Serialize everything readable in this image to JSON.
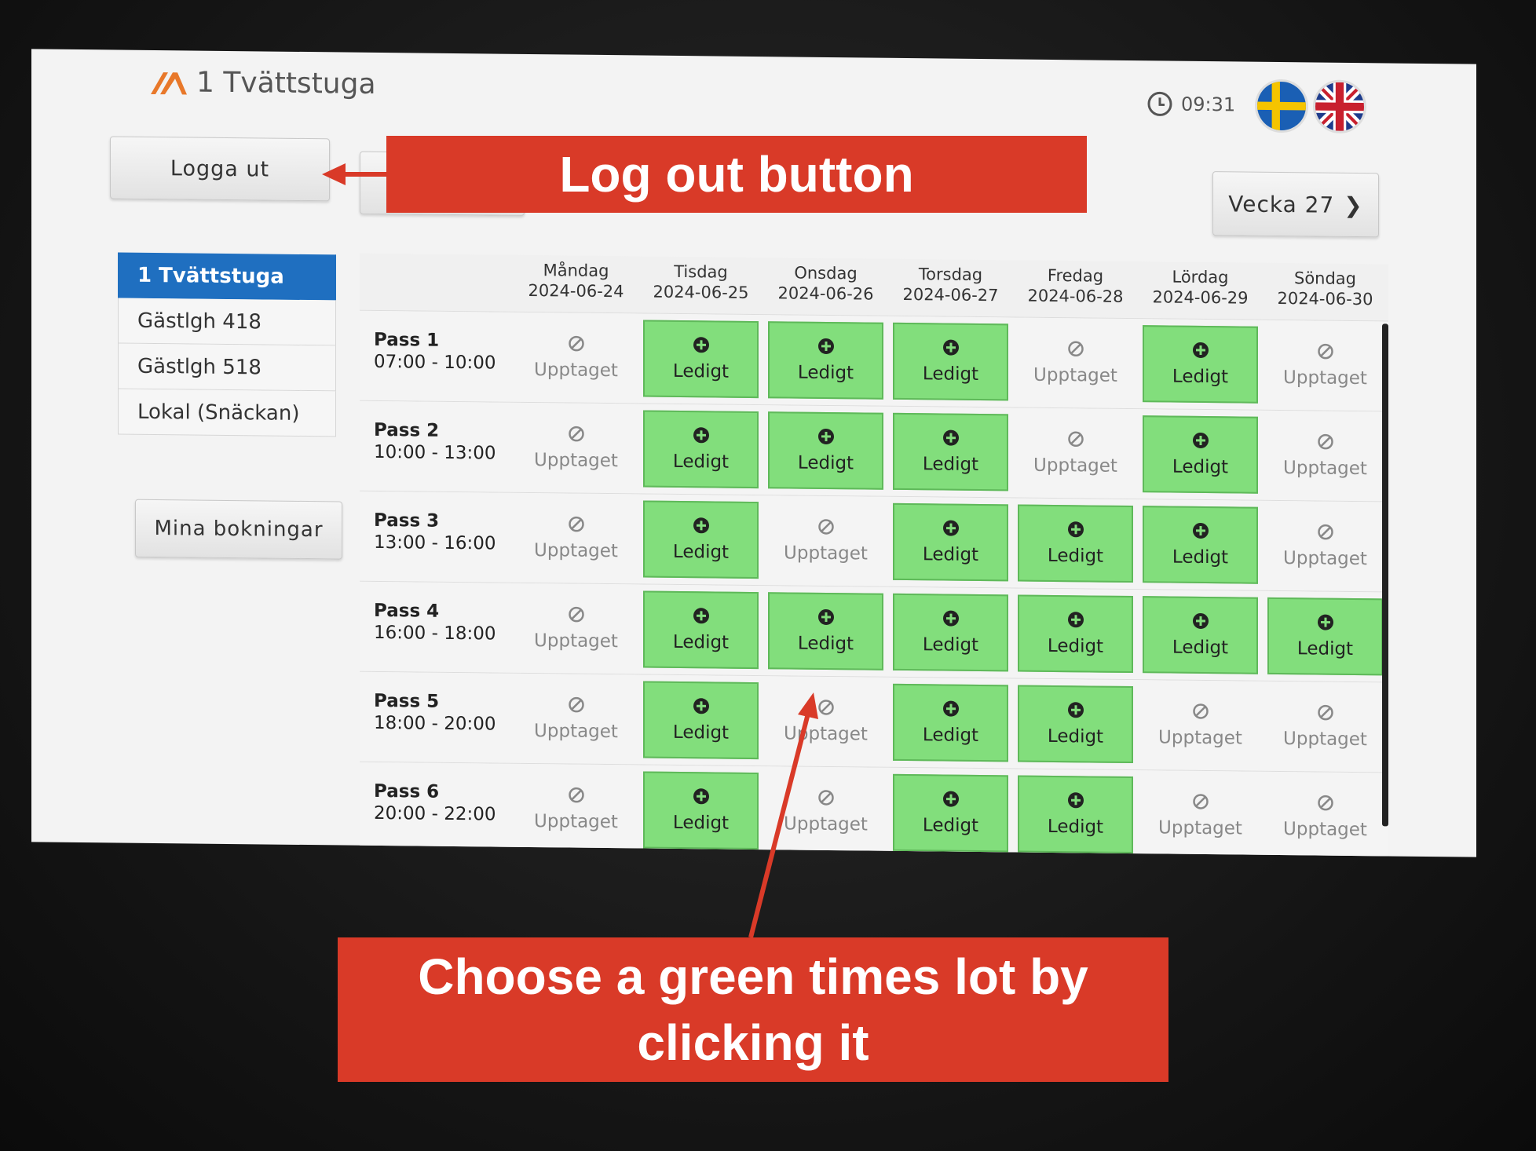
{
  "app": {
    "title": "1 Tvättstuga",
    "time": "09:31",
    "languages": [
      "swedish-flag-icon",
      "uk-flag-icon"
    ]
  },
  "toolbar": {
    "logout_label": "Logga ut",
    "prev_week_label": "",
    "next_week_label": "Vecka 27"
  },
  "sidebar": {
    "items": [
      {
        "label": "1 Tvättstuga",
        "active": true
      },
      {
        "label": "Gästlgh 418",
        "active": false
      },
      {
        "label": "Gästlgh 518",
        "active": false
      },
      {
        "label": "Lokal (Snäckan)",
        "active": false
      }
    ],
    "my_bookings_label": "Mina bokningar"
  },
  "schedule": {
    "days": [
      {
        "name": "Måndag",
        "date": "2024-06-24"
      },
      {
        "name": "Tisdag",
        "date": "2024-06-25"
      },
      {
        "name": "Onsdag",
        "date": "2024-06-26"
      },
      {
        "name": "Torsdag",
        "date": "2024-06-27"
      },
      {
        "name": "Fredag",
        "date": "2024-06-28"
      },
      {
        "name": "Lördag",
        "date": "2024-06-29"
      },
      {
        "name": "Söndag",
        "date": "2024-06-30"
      }
    ],
    "free_label": "Ledigt",
    "busy_label": "Upptaget",
    "passes": [
      {
        "name": "Pass 1",
        "time": "07:00 - 10:00",
        "slots": [
          "busy",
          "free",
          "free",
          "free",
          "busy",
          "free",
          "busy"
        ]
      },
      {
        "name": "Pass 2",
        "time": "10:00 - 13:00",
        "slots": [
          "busy",
          "free",
          "free",
          "free",
          "busy",
          "free",
          "busy"
        ]
      },
      {
        "name": "Pass 3",
        "time": "13:00 - 16:00",
        "slots": [
          "busy",
          "free",
          "busy",
          "free",
          "free",
          "free",
          "busy"
        ]
      },
      {
        "name": "Pass 4",
        "time": "16:00 - 18:00",
        "slots": [
          "busy",
          "free",
          "free",
          "free",
          "free",
          "free",
          "free"
        ]
      },
      {
        "name": "Pass 5",
        "time": "18:00 - 20:00",
        "slots": [
          "busy",
          "free",
          "busy",
          "free",
          "free",
          "busy",
          "busy"
        ]
      },
      {
        "name": "Pass 6",
        "time": "20:00 - 22:00",
        "slots": [
          "busy",
          "free",
          "busy",
          "free",
          "free",
          "busy",
          "busy"
        ]
      }
    ],
    "colors": {
      "free": "#82de7c",
      "free_border": "#5fb95a",
      "active_tab": "#1f6fc0"
    }
  },
  "annotations": {
    "logout_note": "Log out button",
    "choose_note": "Choose a green times lot by clicking it",
    "color": "#d93a28"
  }
}
